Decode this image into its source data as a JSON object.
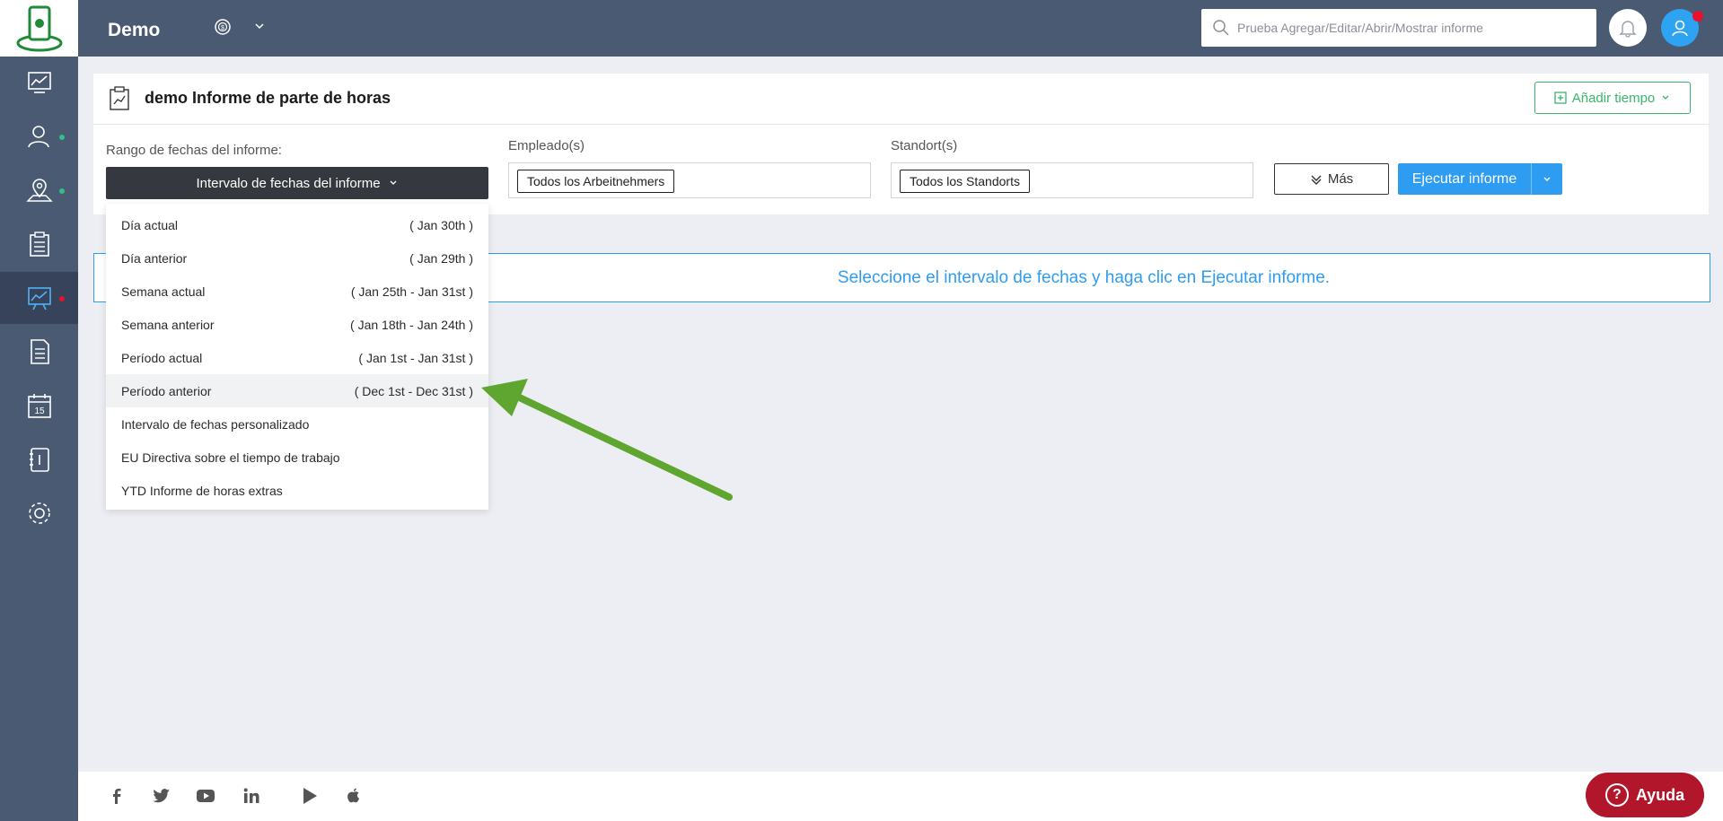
{
  "header": {
    "app_title": "Demo",
    "search_placeholder": "Prueba Agregar/Editar/Abrir/Mostrar informe"
  },
  "sidebar": {
    "items": [
      {
        "icon": "dashboard-chart-icon"
      },
      {
        "icon": "users-icon",
        "dot": "#2ec08b"
      },
      {
        "icon": "map-location-icon",
        "dot": "#2ec08b"
      },
      {
        "icon": "timesheet-clipboard-icon"
      },
      {
        "icon": "reports-chart-icon",
        "dot": "#e8102b",
        "active": true
      },
      {
        "icon": "document-icon"
      },
      {
        "icon": "calendar-icon"
      },
      {
        "icon": "notebook-icon"
      },
      {
        "icon": "gear-icon"
      }
    ]
  },
  "card": {
    "title": "demo Informe de parte de horas",
    "add_time_label": "Añadir tiempo",
    "range_label": "Rango de fechas del informe:",
    "range_button_label": "Intervalo de fechas del informe",
    "employee_label": "Empleado(s)",
    "employee_value": "Todos los Arbeitnehmers",
    "location_label": "Standort(s)",
    "location_value": "Todos los Standorts",
    "more_label": "Más",
    "run_label": "Ejecutar informe"
  },
  "info_message": "Seleccione el intervalo de fechas y haga clic en Ejecutar informe.",
  "dropdown": {
    "items": [
      {
        "label": "Día actual",
        "range": "( Jan 30th )"
      },
      {
        "label": "Día anterior",
        "range": "( Jan 29th )"
      },
      {
        "label": "Semana actual",
        "range": "( Jan 25th - Jan 31st )"
      },
      {
        "label": "Semana anterior",
        "range": "( Jan 18th - Jan 24th )"
      },
      {
        "label": "Período actual",
        "range": "( Jan 1st - Jan 31st )"
      },
      {
        "label": "Período anterior",
        "range": "( Dec 1st - Dec 31st )",
        "highlighted": true
      },
      {
        "label": "Intervalo de fechas personalizado",
        "range": ""
      },
      {
        "label": "EU Directiva sobre el tiempo de trabajo",
        "range": ""
      },
      {
        "label": "YTD Informe de horas extras",
        "range": ""
      }
    ]
  },
  "footer": {
    "social_icons": [
      "facebook-icon",
      "twitter-icon",
      "youtube-icon",
      "linkedin-icon",
      "google-play-icon",
      "apple-icon"
    ],
    "help_label": "Ayuda"
  },
  "colors": {
    "sidebar_bg": "#4a5a72",
    "accent_blue": "#2e9cf1",
    "accent_green": "#3bb46c",
    "help_red": "#b2162b"
  }
}
